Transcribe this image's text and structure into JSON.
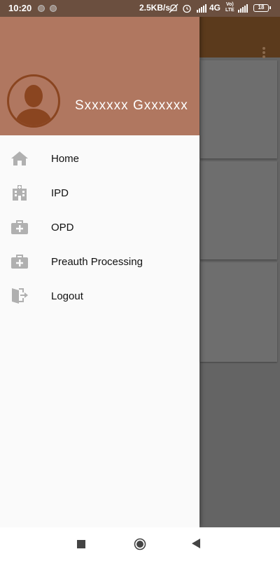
{
  "status_bar": {
    "time": "10:20",
    "net_speed": "2.5KB/s",
    "network": "4G",
    "volte_top": "Vo)",
    "volte_bottom": "LTE",
    "battery": "18"
  },
  "drawer": {
    "user_name": "Sxxxxxx Gxxxxxx",
    "header_color": "#b07760",
    "items": [
      {
        "label": "Home",
        "icon": "home-icon"
      },
      {
        "label": "IPD",
        "icon": "hospital-building-icon"
      },
      {
        "label": "OPD",
        "icon": "medical-kit-icon"
      },
      {
        "label": "Preauth Processing",
        "icon": "medical-kit-icon"
      },
      {
        "label": "Logout",
        "icon": "logout-door-icon"
      }
    ]
  },
  "app": {
    "toolbar_color": "#5b3a1c",
    "overflow_icon": "more-vertical-icon"
  },
  "nav_bar": {
    "recents_icon": "square-icon",
    "home_icon": "circle-icon",
    "back_icon": "triangle-back-icon"
  }
}
